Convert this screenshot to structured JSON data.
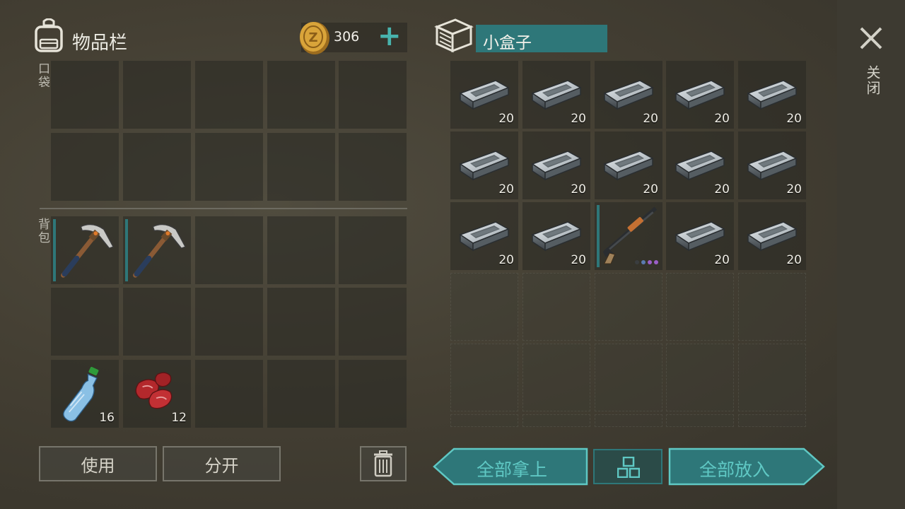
{
  "inventory": {
    "title": "物品栏",
    "pocket_label": "口袋",
    "backpack_label": "背包",
    "coins": "306",
    "add_symbol": "+",
    "items": [
      {
        "type": "pickaxe",
        "count": null
      },
      {
        "type": "pickaxe",
        "count": null
      },
      {
        "type": "water-bottle",
        "count": "16"
      },
      {
        "type": "raw-meat",
        "count": "12"
      }
    ]
  },
  "container": {
    "title": "小盒子",
    "rows": [
      [
        {
          "type": "iron-ingot",
          "count": "20"
        },
        {
          "type": "iron-ingot",
          "count": "20"
        },
        {
          "type": "iron-ingot",
          "count": "20"
        },
        {
          "type": "iron-ingot",
          "count": "20"
        },
        {
          "type": "iron-ingot",
          "count": "20"
        }
      ],
      [
        {
          "type": "iron-ingot",
          "count": "20"
        },
        {
          "type": "iron-ingot",
          "count": "20"
        },
        {
          "type": "iron-ingot",
          "count": "20"
        },
        {
          "type": "iron-ingot",
          "count": "20"
        },
        {
          "type": "iron-ingot",
          "count": "20"
        }
      ],
      [
        {
          "type": "iron-ingot",
          "count": "20"
        },
        {
          "type": "iron-ingot",
          "count": "20"
        },
        {
          "type": "shotgun",
          "count": null
        },
        {
          "type": "iron-ingot",
          "count": "20"
        },
        {
          "type": "iron-ingot",
          "count": "20"
        }
      ]
    ]
  },
  "buttons": {
    "use": "使用",
    "split": "分开",
    "take_all": "全部拿上",
    "put_all": "全部放入"
  },
  "sidebar": {
    "close_label": "关闭"
  },
  "colors": {
    "teal": "#2e7779",
    "teal_light": "#5fc8c4",
    "coin": "#d7a53a"
  }
}
